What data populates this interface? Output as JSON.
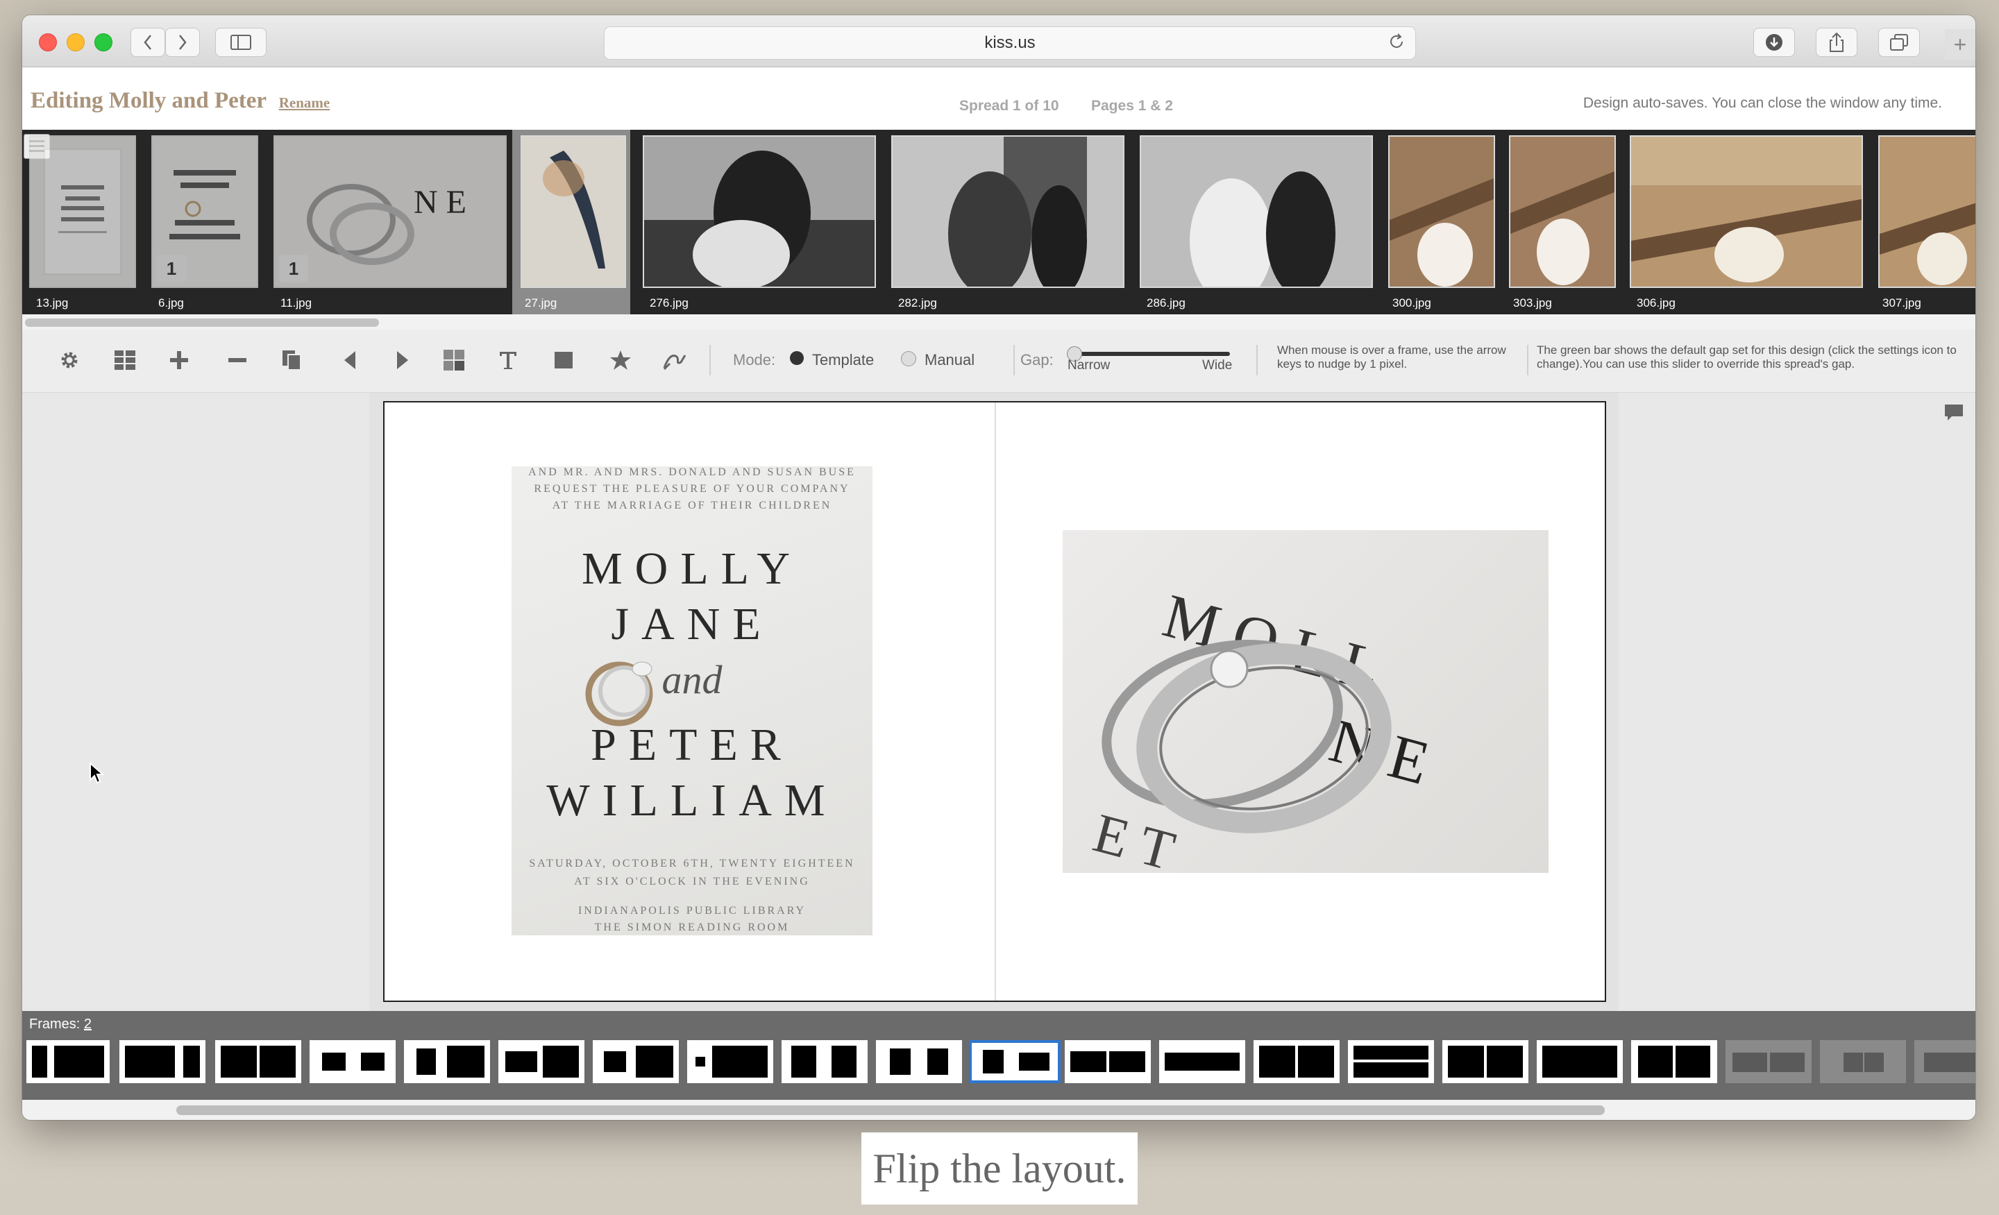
{
  "browser": {
    "url": "kiss.us",
    "colors": {
      "close": "#fe5f57",
      "minimize": "#febc2e",
      "maximize": "#28c840"
    }
  },
  "header": {
    "title": "Editing Molly and Peter",
    "rename_label": "Rename",
    "spread": "Spread 1 of 10",
    "pages": "Pages 1 & 2",
    "autosave_note": "Design auto-saves. You can close the window any time."
  },
  "filmstrip": {
    "photos": [
      {
        "name": "13.jpg",
        "badge": ""
      },
      {
        "name": "6.jpg",
        "badge": "1"
      },
      {
        "name": "11.jpg",
        "badge": "1"
      },
      {
        "name": "27.jpg",
        "badge": ""
      },
      {
        "name": "276.jpg",
        "badge": ""
      },
      {
        "name": "282.jpg",
        "badge": ""
      },
      {
        "name": "286.jpg",
        "badge": ""
      },
      {
        "name": "300.jpg",
        "badge": ""
      },
      {
        "name": "303.jpg",
        "badge": ""
      },
      {
        "name": "306.jpg",
        "badge": ""
      },
      {
        "name": "307.jpg",
        "badge": ""
      }
    ]
  },
  "toolbar": {
    "mode_label": "Mode:",
    "mode_template": "Template",
    "mode_manual": "Manual",
    "mode_selected": "Template",
    "gap_label": "Gap:",
    "gap_narrow": "Narrow",
    "gap_wide": "Wide",
    "gap_value": 0,
    "nudge_note": "When mouse is over a frame, use the arrow keys to nudge by 1 pixel.",
    "gap_note": "The green bar shows the default gap set for this design (click the settings icon to change).You can use this slider to override this spread's gap."
  },
  "invitation": {
    "top_line1": "AND MR. AND MRS. DONALD AND SUSAN BUSE",
    "top_line2": "REQUEST THE PLEASURE OF YOUR COMPANY",
    "top_line3": "AT THE MARRIAGE OF THEIR CHILDREN",
    "name1": "MOLLY",
    "name2": "JANE",
    "and": "and",
    "name3": "PETER",
    "name4": "WILLIAM",
    "date_line1": "SATURDAY, OCTOBER 6TH, TWENTY EIGHTEEN",
    "date_line2": "AT SIX O'CLOCK IN THE EVENING",
    "venue_line1": "INDIANAPOLIS PUBLIC LIBRARY",
    "venue_line2": "THE SIMON READING ROOM"
  },
  "frames": {
    "label": "Frames:",
    "count": "2",
    "selected_index": 10
  },
  "caption": "Flip the layout."
}
